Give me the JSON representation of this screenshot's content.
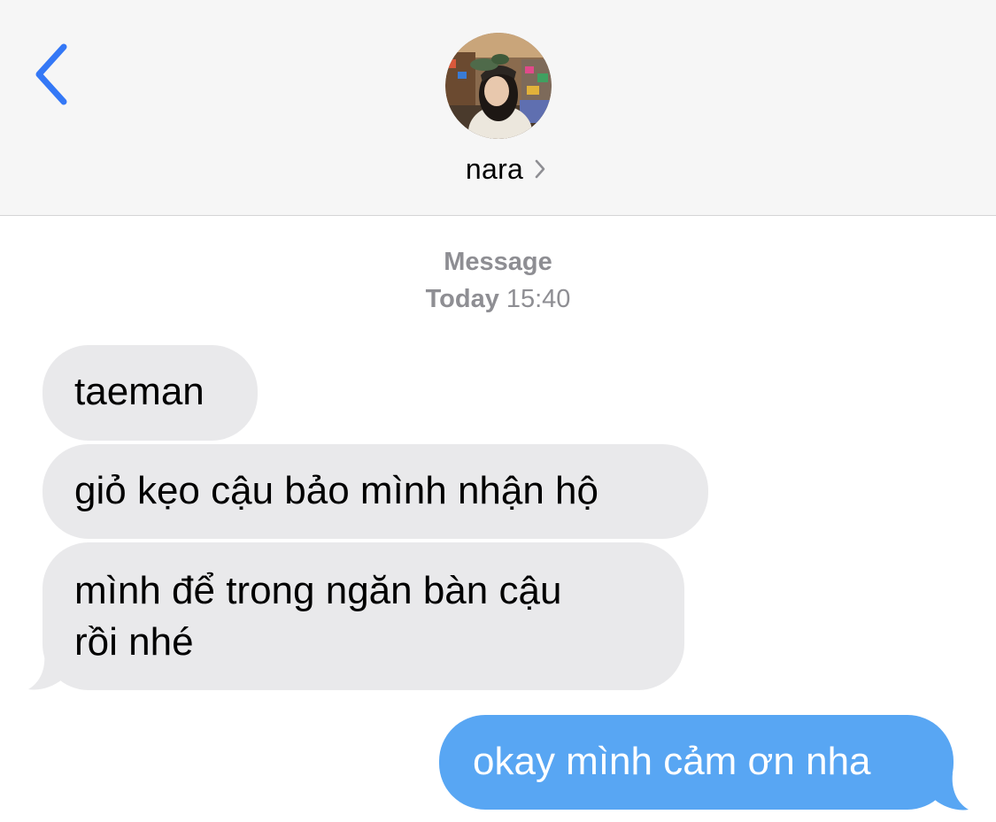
{
  "header": {
    "contact_name": "nara"
  },
  "timestamp": {
    "service": "Message",
    "day": "Today",
    "time": "15:40"
  },
  "messages": [
    {
      "direction": "incoming",
      "text": "taeman"
    },
    {
      "direction": "incoming",
      "text": "giỏ kẹo cậu bảo mình nhận hộ"
    },
    {
      "direction": "incoming",
      "line1": "mình để trong ngăn bàn cậu",
      "line2": "rồi nhé"
    },
    {
      "direction": "outgoing",
      "text": "okay mình cảm ơn nha"
    }
  ],
  "colors": {
    "accent_blue": "#3478f6",
    "incoming_bubble": "#e9e9eb",
    "outgoing_bubble": "#58a6f3",
    "header_bg": "#f6f6f6",
    "secondary_text": "#8e8e93"
  },
  "icons": {
    "back": "chevron-left-icon",
    "contact_details": "chevron-right-icon"
  }
}
